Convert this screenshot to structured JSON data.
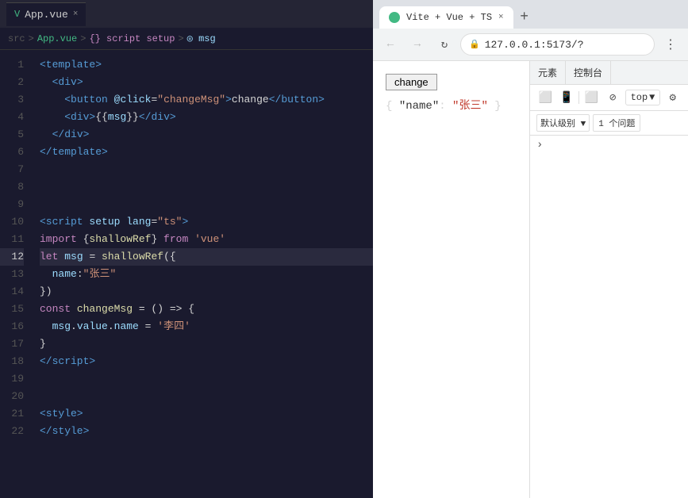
{
  "editor": {
    "tab": {
      "label": "App.vue",
      "close": "×",
      "icon": "V"
    },
    "breadcrumb": {
      "src": "src",
      "arrow1": ">",
      "file": "App.vue",
      "arrow2": ">",
      "script": "{} script setup",
      "arrow3": ">",
      "msg": "◎ msg"
    },
    "lines": [
      {
        "n": 1,
        "active": false
      },
      {
        "n": 2,
        "active": false
      },
      {
        "n": 3,
        "active": false
      },
      {
        "n": 4,
        "active": false
      },
      {
        "n": 5,
        "active": false
      },
      {
        "n": 6,
        "active": false
      },
      {
        "n": 7,
        "active": false
      },
      {
        "n": 8,
        "active": false
      },
      {
        "n": 9,
        "active": false
      },
      {
        "n": 10,
        "active": false
      },
      {
        "n": 11,
        "active": false
      },
      {
        "n": 12,
        "active": true
      },
      {
        "n": 13,
        "active": false
      },
      {
        "n": 14,
        "active": false
      },
      {
        "n": 15,
        "active": false
      },
      {
        "n": 16,
        "active": false
      },
      {
        "n": 17,
        "active": false
      },
      {
        "n": 18,
        "active": false
      },
      {
        "n": 19,
        "active": false
      },
      {
        "n": 20,
        "active": false
      },
      {
        "n": 21,
        "active": false
      },
      {
        "n": 22,
        "active": false
      }
    ]
  },
  "browser": {
    "tab_label": "Vite + Vue + TS",
    "tab_close": "×",
    "new_tab": "+",
    "nav": {
      "back": "←",
      "forward": "→",
      "reload": "↻"
    },
    "address": "127.0.0.1:5173/?",
    "menu": "⋮",
    "change_button": "change",
    "json_display": "{ \"name\": \"张三\" }"
  },
  "devtools": {
    "tabs": [
      "元素",
      "控制台"
    ],
    "toolbar": {
      "top_label": "top",
      "top_arrow": "▼"
    },
    "filter": {
      "level_label": "默认级别",
      "level_arrow": "▼",
      "issue_count": "1 个问题"
    },
    "chevron": "›"
  }
}
